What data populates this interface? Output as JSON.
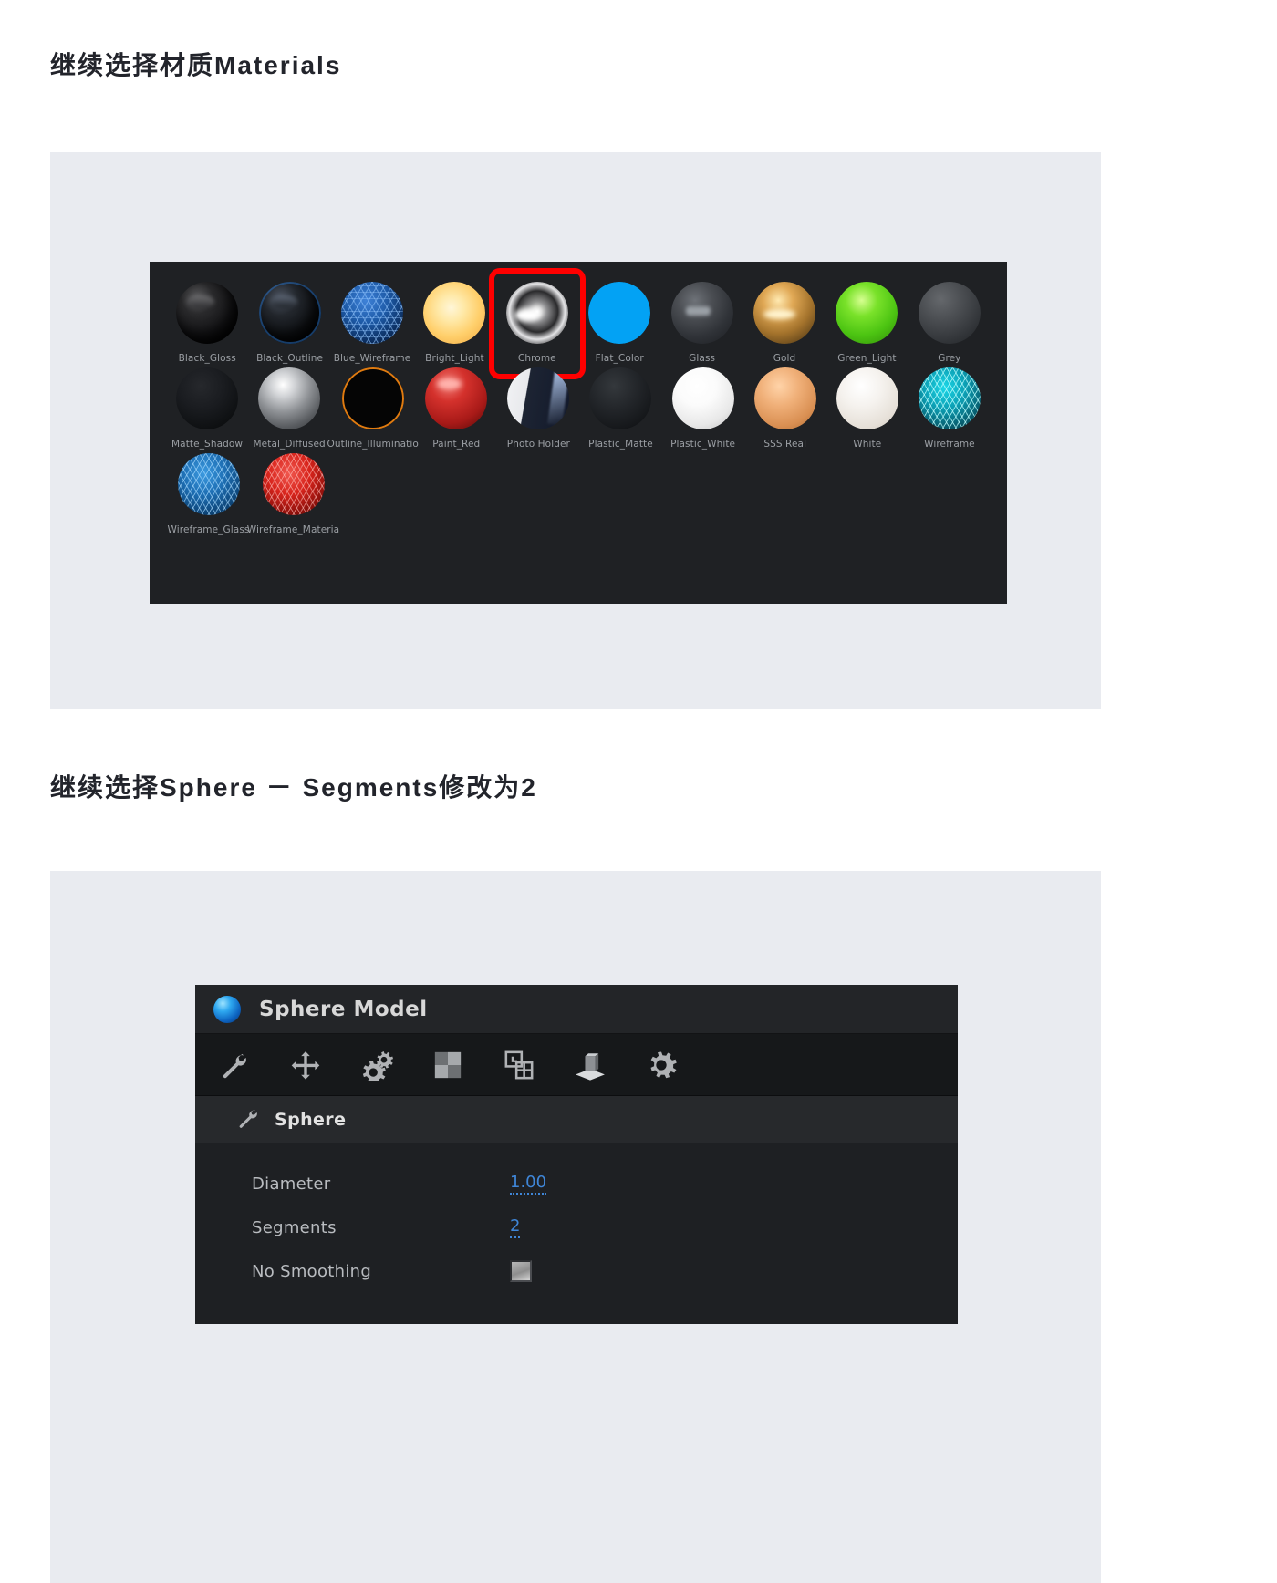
{
  "headings": {
    "first": "继续选择材质Materials",
    "second": "继续选择Sphere － Segments修改为2"
  },
  "material_browser": {
    "name": "material-browser",
    "selected_material": "Chrome",
    "selection_highlight_color": "#ff0000",
    "background_color": "#1f2124",
    "label_color": "#9b9fa4",
    "rows": [
      [
        {
          "label": "Black_Gloss",
          "style": "sph-black-gloss",
          "selected": false
        },
        {
          "label": "Black_Outline",
          "style": "sph-black-outline",
          "selected": false
        },
        {
          "label": "Blue_Wireframe",
          "style": "sph-blue-wire",
          "selected": false
        },
        {
          "label": "Bright_Light",
          "style": "sph-bright",
          "selected": false
        },
        {
          "label": "Chrome",
          "style": "sph-chrome",
          "selected": true
        },
        {
          "label": "Flat_Color",
          "style": "sph-flat",
          "selected": false
        },
        {
          "label": "Glass",
          "style": "sph-glass",
          "selected": false
        },
        {
          "label": "Gold",
          "style": "sph-gold",
          "selected": false
        },
        {
          "label": "Green_Light",
          "style": "sph-green",
          "selected": false
        },
        {
          "label": "Grey",
          "style": "sph-grey",
          "selected": false
        }
      ],
      [
        {
          "label": "Matte_Shadow",
          "style": "sph-matte-shadow",
          "selected": false
        },
        {
          "label": "Metal_Diffused",
          "style": "sph-metal-diff",
          "selected": false
        },
        {
          "label": "Outline_Illuminatio",
          "style": "sph-outline-illum",
          "selected": false
        },
        {
          "label": "Paint_Red",
          "style": "sph-paint-red",
          "selected": false
        },
        {
          "label": "Photo Holder",
          "style": "sph-photo",
          "selected": false
        },
        {
          "label": "Plastic_Matte",
          "style": "sph-plastic-matte",
          "selected": false
        },
        {
          "label": "Plastic_White",
          "style": "sph-plastic-white",
          "selected": false
        },
        {
          "label": "SSS Real",
          "style": "sph-sss",
          "selected": false
        },
        {
          "label": "White",
          "style": "sph-white",
          "selected": false
        },
        {
          "label": "Wireframe",
          "style": "sph-wireframe",
          "selected": false
        }
      ],
      [
        {
          "label": "Wireframe_Glass",
          "style": "sph-wf-glass",
          "selected": false
        },
        {
          "label": "Wireframe_Materia",
          "style": "sph-wf-material",
          "selected": false
        }
      ]
    ]
  },
  "object_panel": {
    "title": "Sphere Model",
    "title_icon": "blue-sphere-icon",
    "toolbar": [
      {
        "icon": "wrench-icon"
      },
      {
        "icon": "move-arrows-icon"
      },
      {
        "icon": "gears-icon"
      },
      {
        "icon": "checkerboard-icon"
      },
      {
        "icon": "transform-frame-icon"
      },
      {
        "icon": "object-cube-icon"
      },
      {
        "icon": "gear-icon"
      }
    ],
    "section": {
      "icon": "wrench-icon",
      "label": "Sphere"
    },
    "parameters": [
      {
        "label": "Diameter",
        "value": "1.00",
        "type": "number"
      },
      {
        "label": "Segments",
        "value": "2",
        "type": "number"
      },
      {
        "label": "No Smoothing",
        "value": "",
        "type": "checkbox",
        "checked": false
      }
    ],
    "value_color": "#3f86d8"
  }
}
